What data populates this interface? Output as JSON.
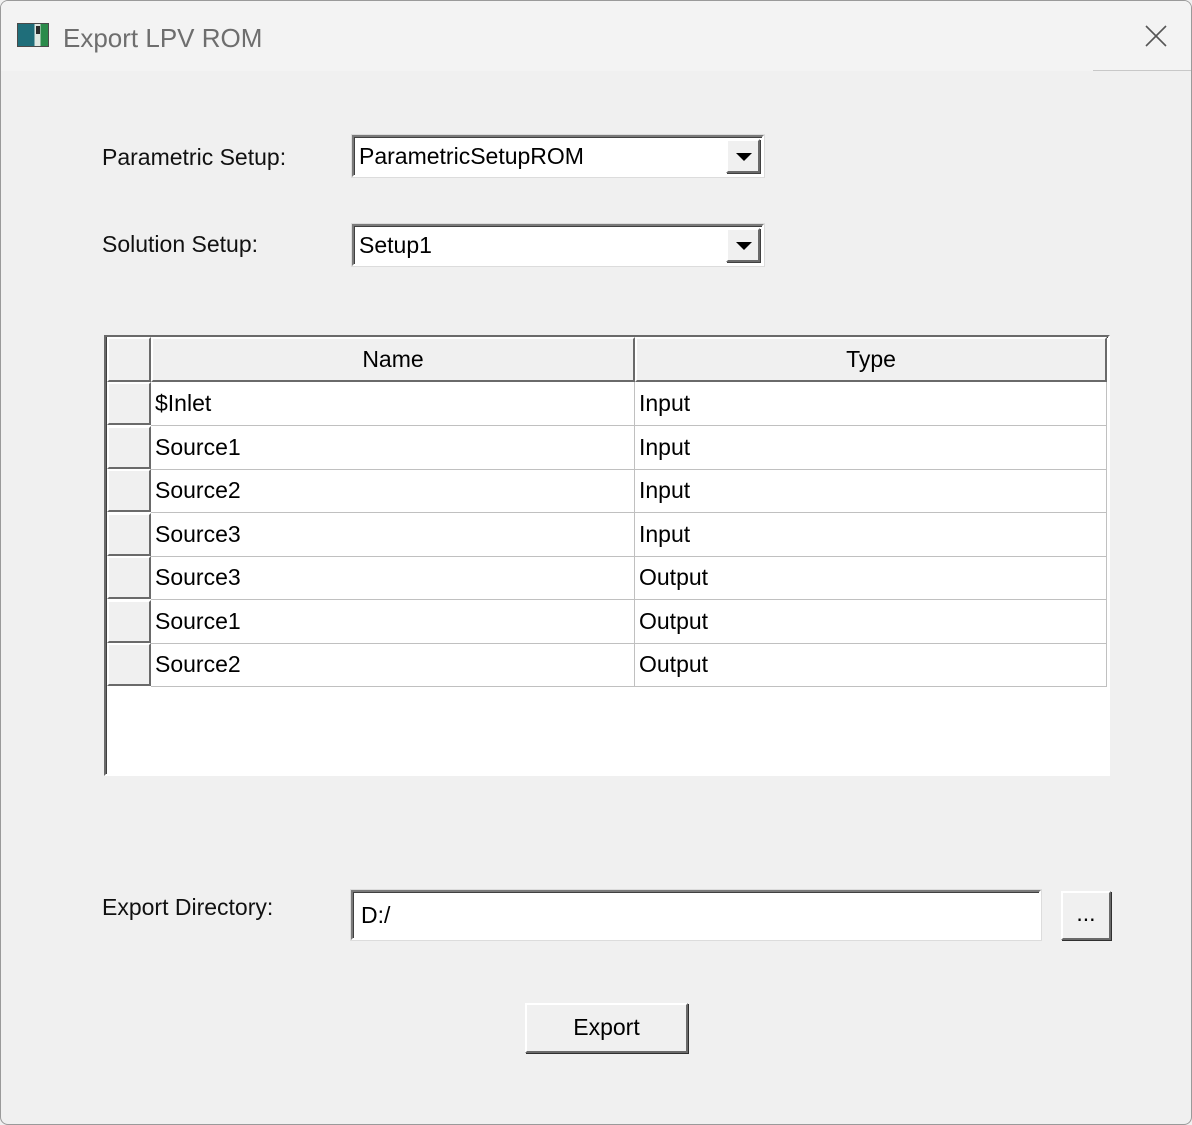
{
  "window": {
    "title": "Export LPV ROM",
    "close_icon": "close-icon"
  },
  "form": {
    "parametric_setup": {
      "label": "Parametric Setup:",
      "value": "ParametricSetupROM"
    },
    "solution_setup": {
      "label": "Solution Setup:",
      "value": "Setup1"
    },
    "export_directory": {
      "label": "Export Directory:",
      "value": "D:/",
      "browse_label": "..."
    }
  },
  "table": {
    "columns": [
      "Name",
      "Type"
    ],
    "rows": [
      {
        "name": "$Inlet",
        "type": "Input"
      },
      {
        "name": "Source1",
        "type": "Input"
      },
      {
        "name": "Source2",
        "type": "Input"
      },
      {
        "name": "Source3",
        "type": "Input"
      },
      {
        "name": "Source3",
        "type": "Output"
      },
      {
        "name": "Source1",
        "type": "Output"
      },
      {
        "name": "Source2",
        "type": "Output"
      }
    ]
  },
  "actions": {
    "export_label": "Export"
  }
}
